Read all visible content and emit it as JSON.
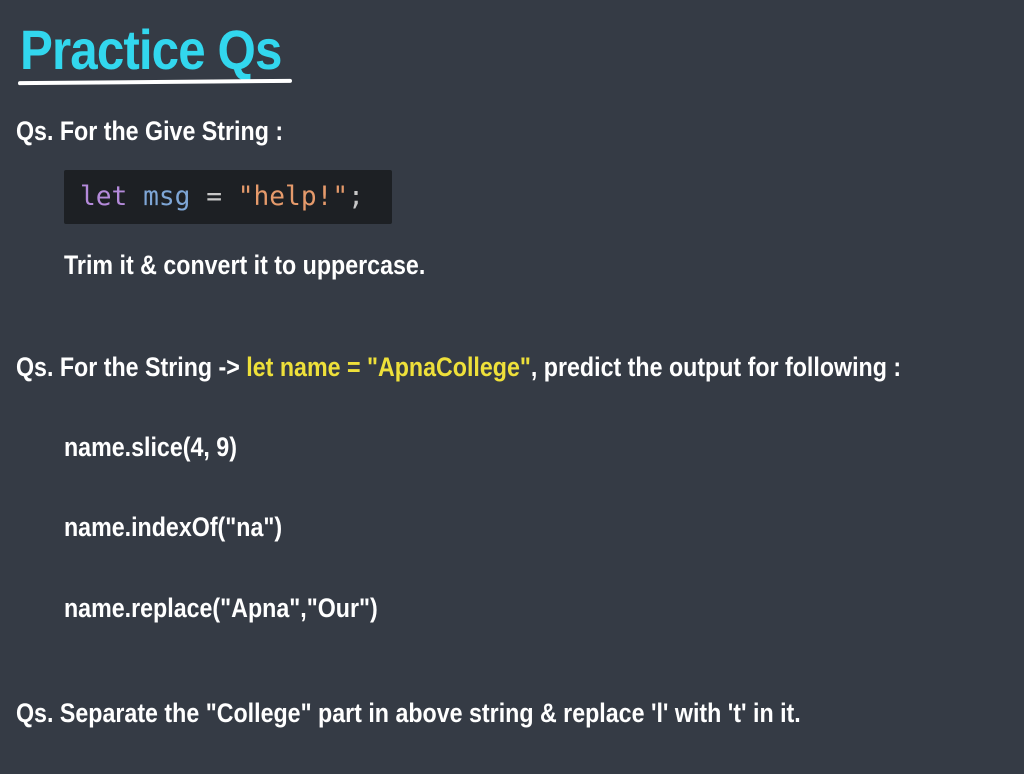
{
  "title": "Practice Qs",
  "question1": {
    "prompt": "Qs. For the Give String :",
    "code": {
      "keyword": "let",
      "variable": "msg",
      "operator": "=",
      "string": "\"help!\"",
      "terminator": ";"
    },
    "instruction": "Trim it & convert it to uppercase."
  },
  "question2": {
    "prefix": "Qs. For the String -> ",
    "highlight": "let name = \"ApnaCollege\"",
    "suffix": ", predict the output for following :",
    "expressions": [
      "name.slice(4, 9)",
      "name.indexOf(\"na\")",
      "name.replace(\"Apna\",\"Our\")"
    ]
  },
  "question3": {
    "prompt": "Qs. Separate the \"College\" part in above string & replace 'l' with 't' in it."
  },
  "colors": {
    "background": "#353b45",
    "title": "#32d7ee",
    "highlight": "#eee03a",
    "code_background": "#1d2024"
  }
}
